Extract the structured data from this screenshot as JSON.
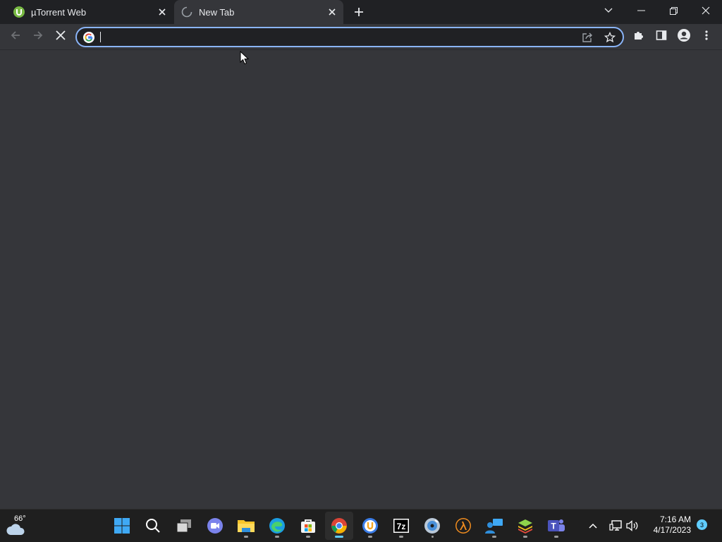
{
  "browser": {
    "tabs": [
      {
        "title": "µTorrent Web",
        "favicon": "utorrent-icon",
        "loading": false,
        "active": false
      },
      {
        "title": "New Tab",
        "favicon": "loading-spinner-icon",
        "loading": true,
        "active": true
      }
    ],
    "omnibox": {
      "value": "",
      "placeholder": ""
    },
    "colors": {
      "tabstrip": "#202124",
      "toolbar": "#35363a",
      "omnibox_focus": "#8ab4f8",
      "content": "#35363a"
    }
  },
  "taskbar": {
    "weather": {
      "temp": "66°",
      "icon": "cloudy-weather-icon"
    },
    "apps": [
      "start",
      "search",
      "task-view",
      "chat",
      "file-explorer",
      "edge",
      "microsoft-store",
      "chrome",
      "utorrent",
      "7zip",
      "dvd-player",
      "half-life",
      "remote-desktop",
      "bluestacks",
      "teams"
    ],
    "clock": {
      "time": "7:16 AM",
      "date": "4/17/2023"
    },
    "notifications": "3",
    "accent": "#60cdff"
  }
}
